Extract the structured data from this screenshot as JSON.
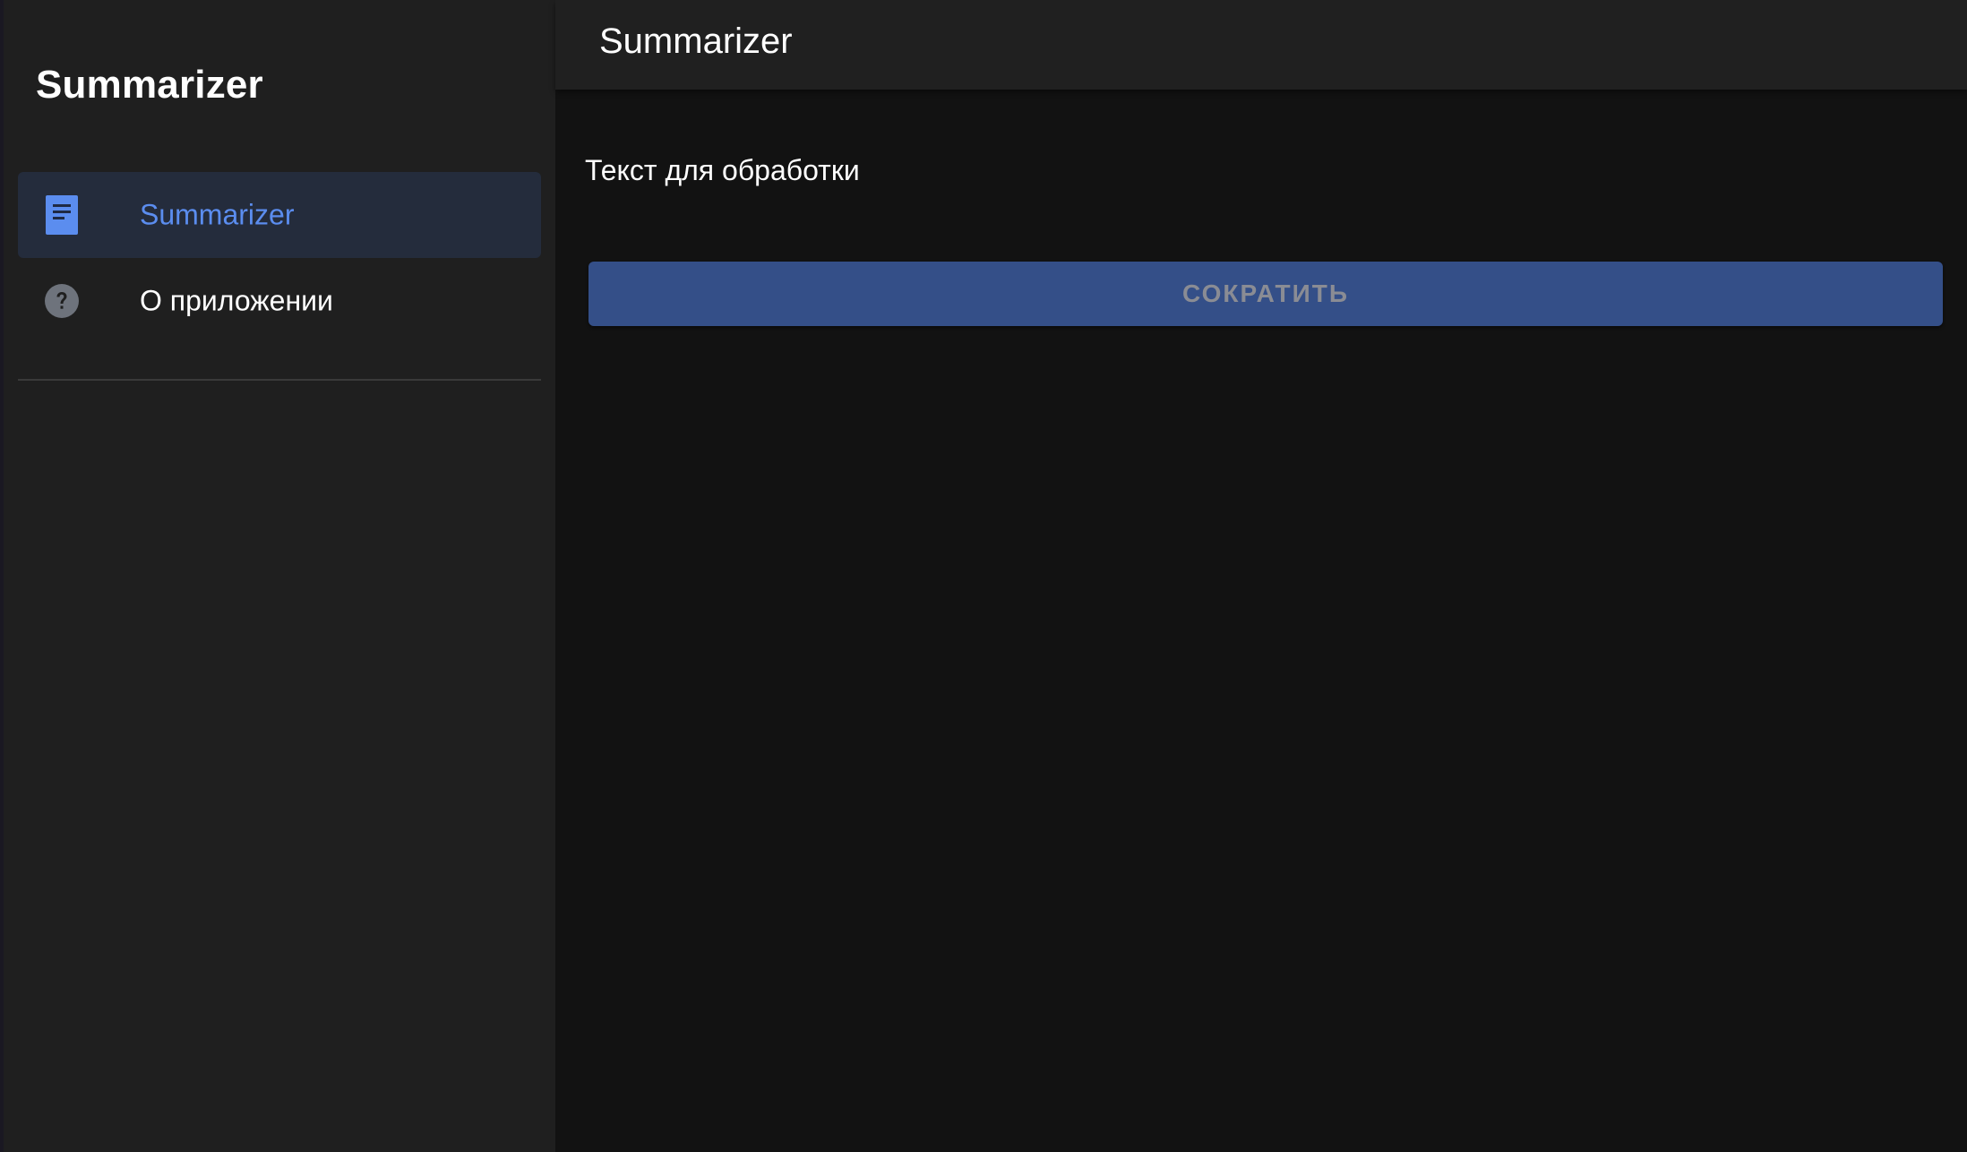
{
  "app": {
    "drawer_title": "Summarizer",
    "topbar_title": "Summarizer"
  },
  "sidebar": {
    "items": [
      {
        "label": "Summarizer",
        "icon": "document-icon",
        "active": true
      },
      {
        "label": "О приложении",
        "icon": "help-icon",
        "active": false
      }
    ]
  },
  "main": {
    "input_label": "Текст для обработки",
    "summarize_button": "СОКРАТИТЬ"
  },
  "colors": {
    "accent": "#5b8def",
    "active_item_bg": "#242c3c",
    "button_bg": "#344f88",
    "sidebar_bg": "#1f1f1f",
    "content_bg": "#121212"
  }
}
